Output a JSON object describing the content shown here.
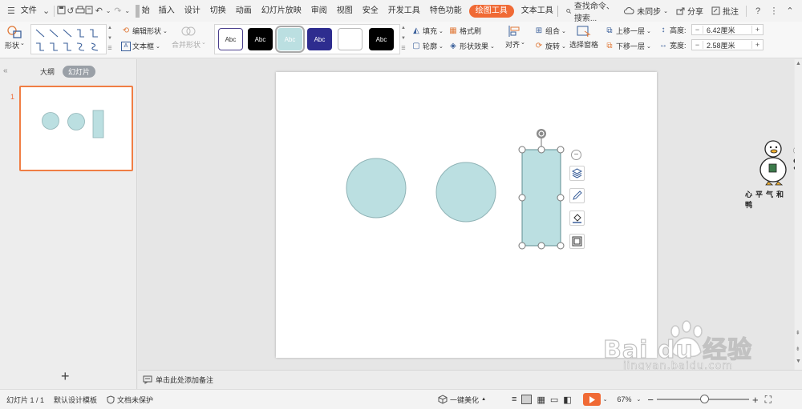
{
  "menubar": {
    "file_label": "文件",
    "tabs": [
      "插入",
      "设计",
      "切换",
      "动画",
      "幻灯片放映",
      "审阅",
      "视图",
      "安全",
      "开发工具",
      "特色功能"
    ],
    "active_tab": "绘图工具",
    "text_tool_tab": "文本工具",
    "search_label": "查找命令、搜索...",
    "sync_label": "未同步",
    "share_label": "分享",
    "annotate_label": "批注",
    "help_label": "?"
  },
  "ribbon": {
    "shape_label": "形状",
    "edit_shape_label": "编辑形状",
    "textbox_label": "文本框",
    "merge_shape_label": "合并形状",
    "style_swatches": [
      "Abc",
      "Abc",
      "Abc",
      "Abc",
      "",
      "Abc"
    ],
    "fill_label": "填充",
    "format_brush_label": "格式刷",
    "outline_label": "轮廓",
    "shape_effect_label": "形状效果",
    "align_label": "对齐",
    "group_label": "组合",
    "rotate_label": "旋转",
    "selection_pane_label": "选择窗格",
    "bring_forward_label": "上移一层",
    "send_backward_label": "下移一层",
    "height_label": "高度:",
    "height_value": "6.42厘米",
    "width_label": "宽度:",
    "width_value": "2.58厘米"
  },
  "leftpanel": {
    "outline_tab": "大纲",
    "slides_tab": "幻灯片",
    "slide_number": "1",
    "add_slide": "+"
  },
  "notes": {
    "placeholder": "单击此处添加备注"
  },
  "statusbar": {
    "slide_info": "幻灯片 1 / 1",
    "template": "默认设计模板",
    "protection": "文档未保护",
    "beautify": "一键美化",
    "zoom": "67%",
    "zoom_fraction": 0.52
  },
  "watermark": {
    "caption": "心平气和鸭",
    "brand": "Bai du 经验",
    "url": "jingyan.baidu.com"
  },
  "colors": {
    "accent": "#f06a35",
    "shape_fill": "#bbdfe1",
    "shape_stroke": "#8fb3b6"
  }
}
